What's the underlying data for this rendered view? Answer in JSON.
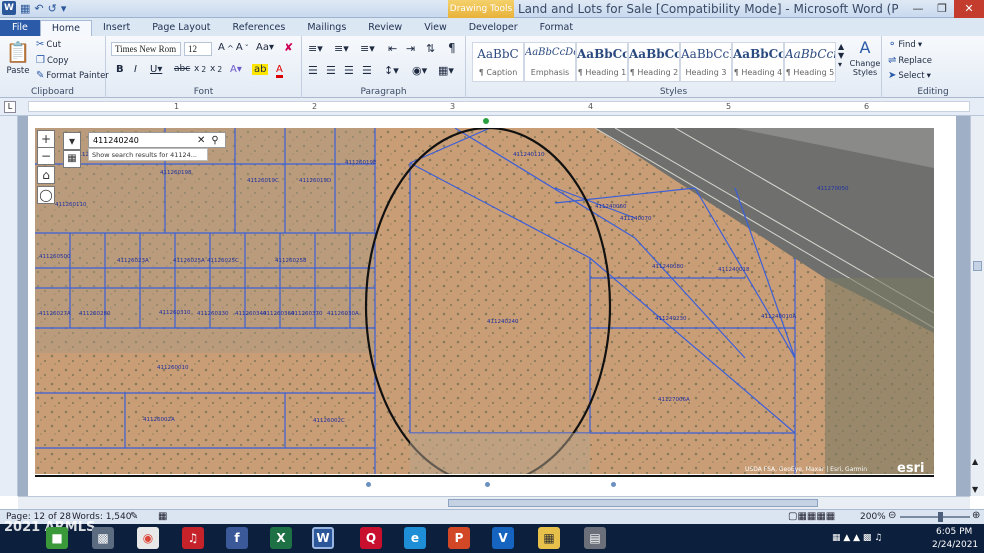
{
  "window": {
    "title": "Land and Lots for Sale [Compatibility Mode] - Microsoft Word (Product Activ...",
    "context_tab": "Drawing Tools"
  },
  "tabs": [
    "File",
    "Home",
    "Insert",
    "Page Layout",
    "References",
    "Mailings",
    "Review",
    "View",
    "Developer",
    "Format"
  ],
  "clipboard": {
    "paste": "Paste",
    "cut": "Cut",
    "copy": "Copy",
    "format_painter": "Format Painter",
    "label": "Clipboard"
  },
  "font": {
    "name": "Times New Rom",
    "size": "12",
    "label": "Font"
  },
  "paragraph": {
    "label": "Paragraph"
  },
  "styles": {
    "items": [
      {
        "preview": "AaBbC",
        "name": "¶ Caption"
      },
      {
        "preview": "AaBbCcDc",
        "name": "Emphasis"
      },
      {
        "preview": "AaBbCc",
        "name": "¶ Heading 1"
      },
      {
        "preview": "AaBbCcl",
        "name": "¶ Heading 2"
      },
      {
        "preview": "AaBbCcI",
        "name": "Heading 3"
      },
      {
        "preview": "AaBbCcl",
        "name": "¶ Heading 4"
      },
      {
        "preview": "AaBbCci",
        "name": "¶ Heading 5"
      }
    ],
    "change": "Change Styles",
    "label": "Styles"
  },
  "editing": {
    "find": "Find",
    "replace": "Replace",
    "select": "Select",
    "label": "Editing"
  },
  "ruler_numbers": [
    "1",
    "2",
    "3",
    "4",
    "5",
    "6"
  ],
  "map": {
    "search_value": "411240240",
    "search_tip": "Show search results for 41124...",
    "parcel_labels": [
      {
        "id": "411240110"
      },
      {
        "id": "411240060"
      },
      {
        "id": "411240070"
      },
      {
        "id": "411240080"
      },
      {
        "id": "411240018"
      },
      {
        "id": "411240240"
      },
      {
        "id": "411240230"
      },
      {
        "id": "411240010A"
      },
      {
        "id": "411270050"
      },
      {
        "id": "41127006A"
      },
      {
        "id": "411260190"
      },
      {
        "id": "411260198"
      },
      {
        "id": "41126019C"
      },
      {
        "id": "41126019D"
      },
      {
        "id": "41126019E"
      },
      {
        "id": "411260110"
      },
      {
        "id": "41126023A"
      },
      {
        "id": "41126025A"
      },
      {
        "id": "41126025C"
      },
      {
        "id": "411260258"
      },
      {
        "id": "41126027A"
      },
      {
        "id": "411260280"
      },
      {
        "id": "411260310"
      },
      {
        "id": "411260330"
      },
      {
        "id": "411260340"
      },
      {
        "id": "411260360"
      },
      {
        "id": "411260370"
      },
      {
        "id": "41126030A"
      },
      {
        "id": "411260010"
      },
      {
        "id": "41126002A"
      },
      {
        "id": "41126002C"
      },
      {
        "id": "411260500"
      }
    ],
    "attribution": "USDA FSA, GeoEye, Maxar | Esri, Garmin",
    "brand": "esri"
  },
  "status": {
    "page": "Page: 12 of 28",
    "words": "Words: 1,540",
    "zoom": "200%"
  },
  "taskbar": {
    "time": "6:05 PM",
    "date": "2/24/2021",
    "watermark": "2021 ARMLS"
  }
}
